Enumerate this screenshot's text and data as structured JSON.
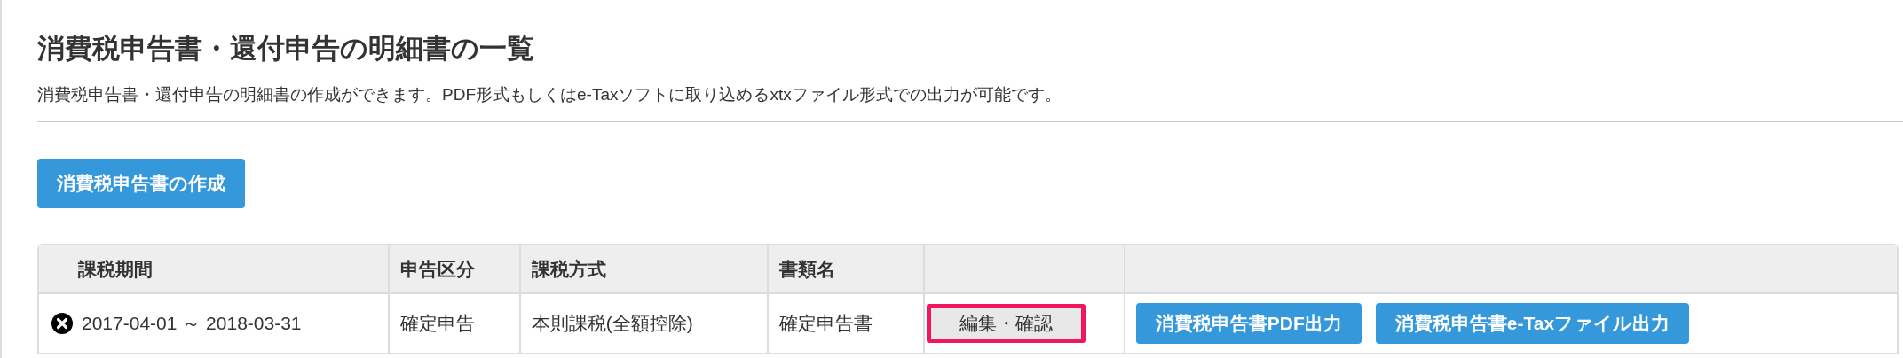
{
  "title": "消費税申告書・還付申告の明細書の一覧",
  "description": "消費税申告書・還付申告の明細書の作成ができます。PDF形式もしくはe-Taxソフトに取り込めるxtxファイル形式での出力が可能です。",
  "create_button": "消費税申告書の作成",
  "table": {
    "columns": [
      "課税期間",
      "申告区分",
      "課税方式",
      "書類名"
    ],
    "rows": [
      {
        "period": "2017-04-01 ～ 2018-03-31",
        "category": "確定申告",
        "method": "本則課税(全額控除)",
        "document": "確定申告書",
        "actions": [
          {
            "label": "編集・確認",
            "kind": "secondary",
            "highlighted": true
          },
          {
            "label": "消費税申告書PDF出力",
            "kind": "primary",
            "highlighted": false
          },
          {
            "label": "消費税申告書e-Taxファイル出力",
            "kind": "primary",
            "highlighted": false
          }
        ]
      }
    ]
  }
}
